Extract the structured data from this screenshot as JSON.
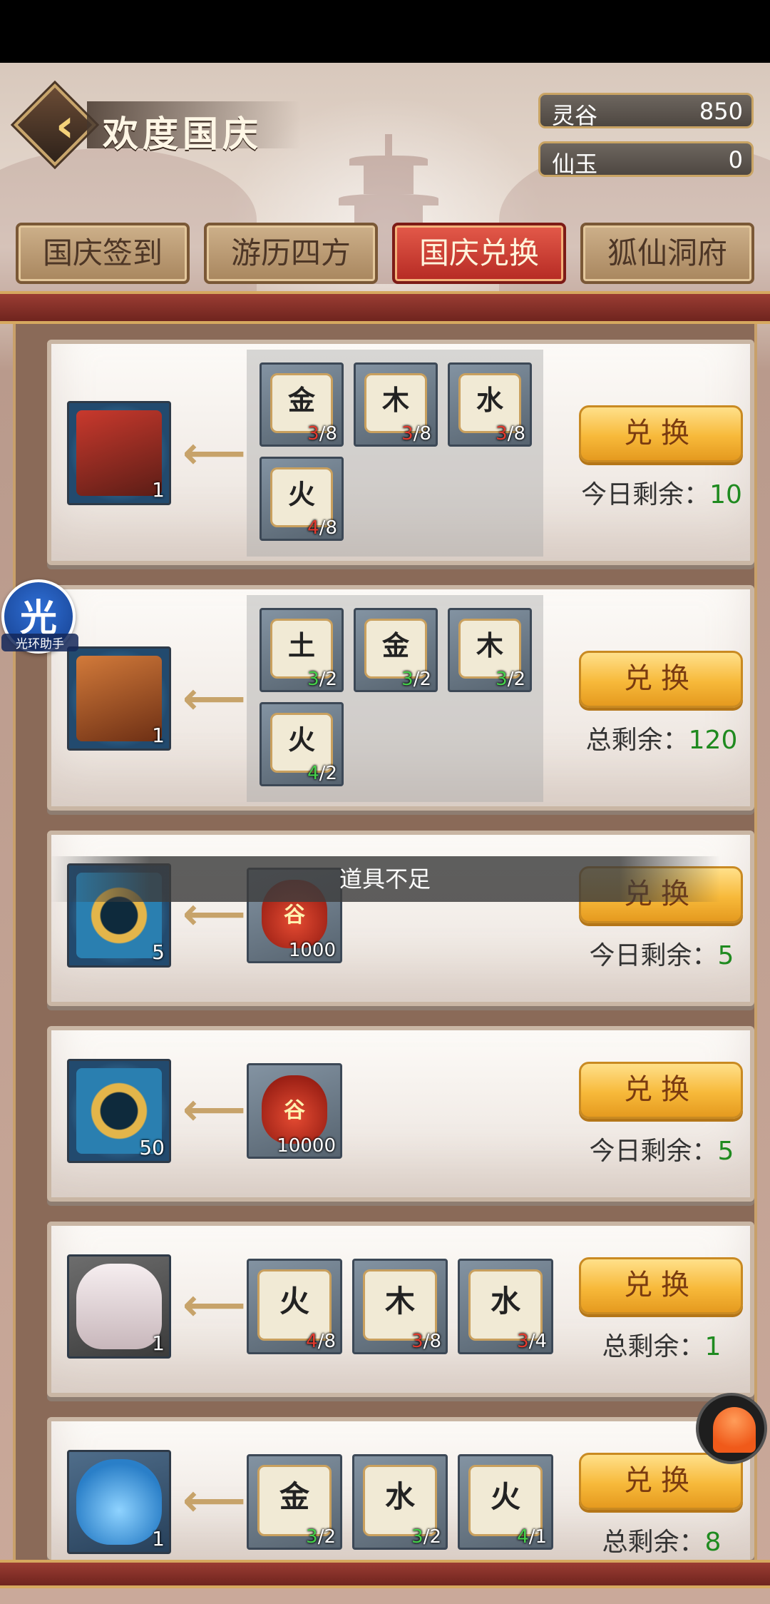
{
  "header": {
    "title": "欢度国庆",
    "currencies": [
      {
        "label": "灵谷",
        "value": "850"
      },
      {
        "label": "仙玉",
        "value": "0"
      }
    ]
  },
  "tabs": [
    {
      "label": "国庆签到",
      "active": false
    },
    {
      "label": "游历四方",
      "active": false
    },
    {
      "label": "国庆兑换",
      "active": true
    },
    {
      "label": "狐仙洞府",
      "active": false
    }
  ],
  "toast": "道具不足",
  "float_badge": {
    "char": "光",
    "label": "光环助手"
  },
  "cards": [
    {
      "reward_count": "1",
      "requirements": [
        {
          "char": "金",
          "have": "3",
          "need": "/8"
        },
        {
          "char": "木",
          "have": "3",
          "need": "/8"
        },
        {
          "char": "水",
          "have": "3",
          "need": "/8"
        },
        {
          "char": "火",
          "have": "4",
          "need": "/8"
        }
      ],
      "button": "兑换",
      "remain_label": "今日剩余：",
      "remain_value": "10"
    },
    {
      "reward_count": "1",
      "requirements": [
        {
          "char": "土",
          "have": "3",
          "need": "/2"
        },
        {
          "char": "金",
          "have": "3",
          "need": "/2"
        },
        {
          "char": "木",
          "have": "3",
          "need": "/2"
        },
        {
          "char": "火",
          "have": "4",
          "need": "/2"
        }
      ],
      "button": "兑换",
      "remain_label": "总剩余：",
      "remain_value": "120"
    },
    {
      "reward_count": "5",
      "bag": {
        "char": "谷",
        "count": "1000"
      },
      "button": "兑换",
      "remain_label": "今日剩余：",
      "remain_value": "5"
    },
    {
      "reward_count": "50",
      "bag": {
        "char": "谷",
        "count": "10000"
      },
      "button": "兑换",
      "remain_label": "今日剩余：",
      "remain_value": "5"
    },
    {
      "reward_count": "1",
      "requirements": [
        {
          "char": "火",
          "have": "4",
          "need": "/8"
        },
        {
          "char": "木",
          "have": "3",
          "need": "/8"
        },
        {
          "char": "水",
          "have": "3",
          "need": "/4"
        }
      ],
      "button": "兑换",
      "remain_label": "总剩余：",
      "remain_value": "1"
    },
    {
      "reward_count": "1",
      "requirements": [
        {
          "char": "金",
          "have": "3",
          "need": "/2"
        },
        {
          "char": "水",
          "have": "3",
          "need": "/2"
        },
        {
          "char": "火",
          "have": "4",
          "need": "/1"
        }
      ],
      "button": "兑换",
      "remain_label": "总剩余：",
      "remain_value": "8"
    }
  ],
  "colors": {
    "accent_red": "#c6342b",
    "gold_button": "#f7b93a",
    "count_insufficient": "#e23a2e",
    "count_sufficient": "#45d04a",
    "remain_value": "#1f8a1f"
  }
}
